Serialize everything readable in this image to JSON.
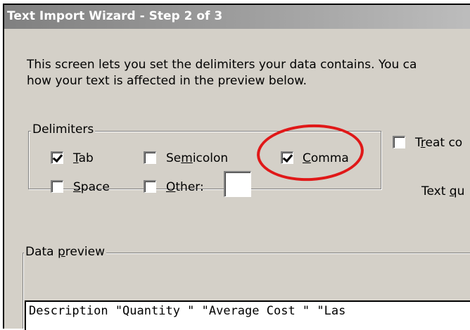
{
  "window": {
    "title": "Text Import Wizard - Step 2 of 3"
  },
  "intro": {
    "line1": "This screen lets you set the delimiters your data contains.  You ca",
    "line2": "how your text is affected in the preview below."
  },
  "delimiters": {
    "legend": "Delimiters",
    "tab": {
      "pre": "",
      "key": "T",
      "post": "ab",
      "checked": true
    },
    "semicolon": {
      "pre": "Se",
      "key": "m",
      "post": "icolon",
      "checked": false
    },
    "comma": {
      "pre": "",
      "key": "C",
      "post": "omma",
      "checked": true
    },
    "space": {
      "pre": "",
      "key": "S",
      "post": "pace",
      "checked": false
    },
    "other": {
      "pre": "",
      "key": "O",
      "post": "ther:",
      "checked": false,
      "value": ""
    }
  },
  "treat_consecutive": {
    "pre": "T",
    "key": "r",
    "post": "eat co",
    "checked": false
  },
  "text_qualifier": {
    "pre": "Text ",
    "key": "q",
    "post": "u"
  },
  "preview": {
    "legend_pre": "Data ",
    "legend_key": "p",
    "legend_post": "review",
    "row1": "Description  \"Quantity \" \"Average Cost \" \"Las"
  },
  "annotation": {
    "color": "#e01818"
  }
}
